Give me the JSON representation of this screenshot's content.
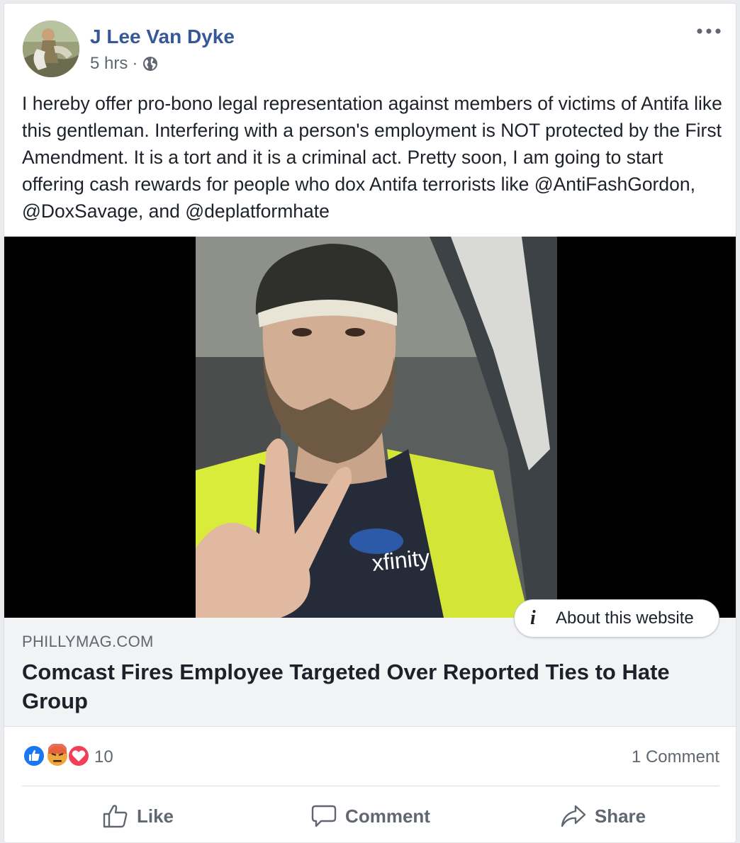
{
  "post": {
    "author": "J Lee Van Dyke",
    "time": "5 hrs",
    "separator": "·",
    "privacy_icon": "globe-icon",
    "more_icon": "more-options-icon",
    "text": "I hereby offer pro-bono legal representation against members of victims of Antifa like this gentleman. Interfering with a person's employment is NOT protected by the First Amendment. It is a tort and it is a criminal act. Pretty soon, I am going to start offering cash rewards for people who dox Antifa terrorists like @AntiFashGordon, @DoxSavage, and @deplatformhate"
  },
  "link_preview": {
    "about_label": "About this website",
    "domain": "PHILLYMAG.COM",
    "headline": "Comcast Fires Employee Targeted Over Reported Ties to Hate Group",
    "image_shirt_logo": "xfinity"
  },
  "engagement": {
    "reaction_types": [
      "like",
      "angry",
      "love"
    ],
    "reaction_count": "10",
    "comment_count": "1 Comment"
  },
  "actions": {
    "like": "Like",
    "comment": "Comment",
    "share": "Share"
  },
  "colors": {
    "author_link": "#365899",
    "like_blue": "#1877f2",
    "angry_orange": "#f0a63a",
    "love_red": "#f33e58",
    "muted_text": "#606770"
  }
}
